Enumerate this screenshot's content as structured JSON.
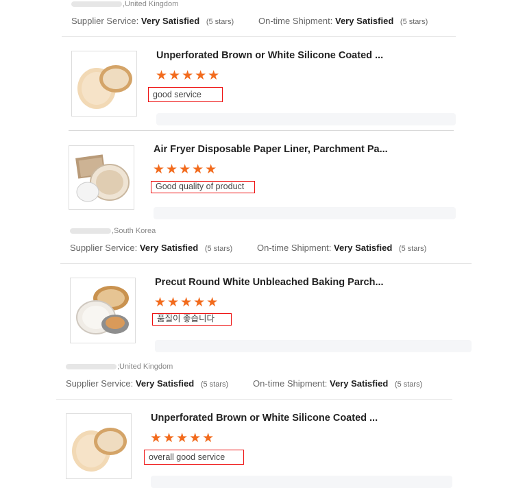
{
  "groups": [
    {
      "location": ",United Kingdom",
      "supplier_label": "Supplier Service:",
      "supplier_value": "Very Satisfied",
      "supplier_stars": "(5 stars)",
      "shipment_label": "On-time Shipment:",
      "shipment_value": "Very Satisfied",
      "shipment_stars": "(5 stars)"
    },
    {
      "location": ",South Korea",
      "supplier_label": "Supplier Service:",
      "supplier_value": "Very Satisfied",
      "supplier_stars": "(5 stars)",
      "shipment_label": "On-time Shipment:",
      "shipment_value": "Very Satisfied",
      "shipment_stars": "(5 stars)"
    },
    {
      "location": ";United Kingdom",
      "supplier_label": "Supplier Service:",
      "supplier_value": "Very Satisfied",
      "supplier_stars": "(5 stars)",
      "shipment_label": "On-time Shipment:",
      "shipment_value": "Very Satisfied",
      "shipment_stars": "(5 stars)"
    }
  ],
  "reviews": [
    {
      "title": "Unperforated Brown or White Silicone Coated ...",
      "rating": 5,
      "stars": "★★★★★",
      "comment": "good service",
      "image_icon": "paper-liner-bowl-icon"
    },
    {
      "title": "Air Fryer Disposable Paper Liner, Parchment Pa...",
      "rating": 5,
      "stars": "★★★★★",
      "comment": "Good quality of product",
      "image_icon": "paper-liner-stack-icon"
    },
    {
      "title": "Precut Round White Unbleached Baking Parch...",
      "rating": 5,
      "stars": "★★★★★",
      "comment": "품질이 좋습니다",
      "image_icon": "baking-paper-rounds-icon"
    },
    {
      "title": "Unperforated Brown or White Silicone Coated ...",
      "rating": 5,
      "stars": "★★★★★",
      "comment": "overall good service",
      "image_icon": "paper-liner-bowl-icon"
    }
  ],
  "colors": {
    "star": "#f26b1d",
    "highlight_box": "#ee1111"
  }
}
